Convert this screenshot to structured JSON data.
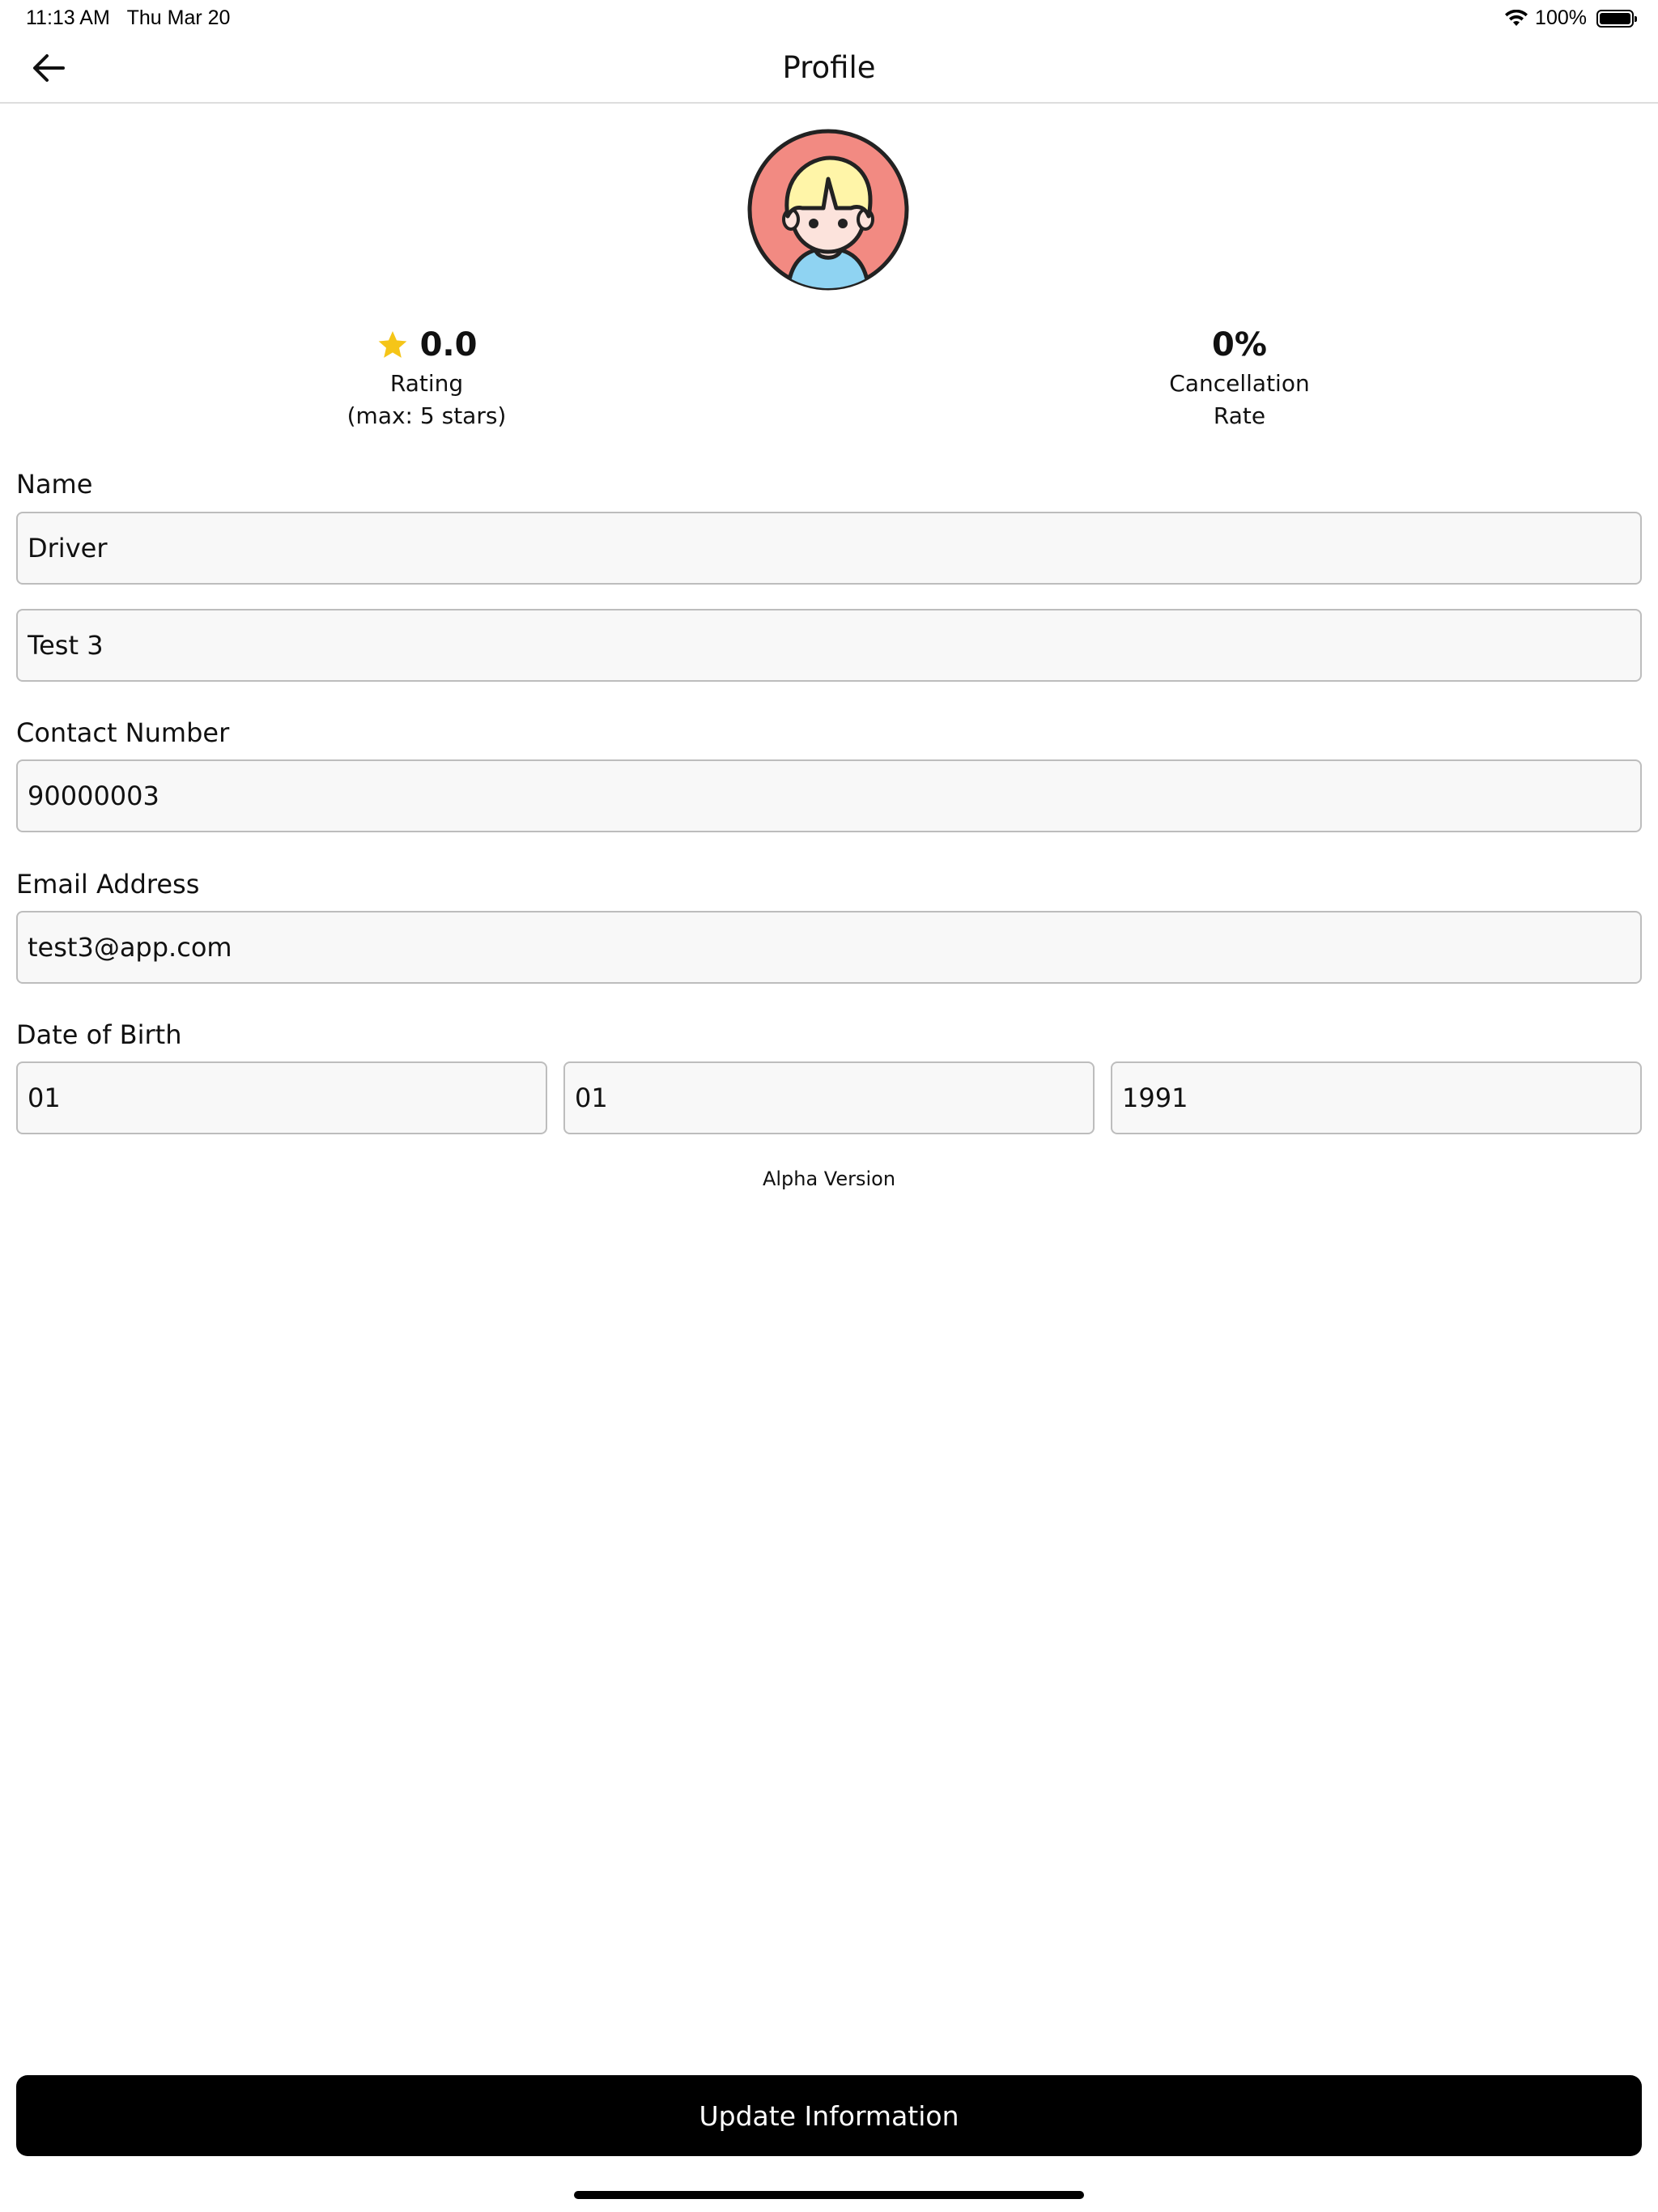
{
  "status_bar": {
    "time": "11:13 AM",
    "date": "Thu Mar 20",
    "battery_text": "100%",
    "battery_level": 1.0
  },
  "header": {
    "title": "Profile"
  },
  "stats": {
    "rating_value": "0.0",
    "rating_label_line1": "Rating",
    "rating_label_line2": "(max: 5 stars)",
    "cancellation_value": "0%",
    "cancellation_label_line1": "Cancellation",
    "cancellation_label_line2": "Rate"
  },
  "form": {
    "name_label": "Name",
    "first_name_value": "Driver",
    "last_name_value": "Test 3",
    "contact_label": "Contact Number",
    "contact_value": "90000003",
    "email_label": "Email Address",
    "email_value": "test3@app.com",
    "dob_label": "Date of Birth",
    "dob_day_value": "01",
    "dob_month_value": "01",
    "dob_year_value": "1991"
  },
  "version_text": "Alpha Version",
  "actions": {
    "update_label": "Update Information"
  },
  "colors": {
    "avatar_bg": "#F28A82",
    "avatar_hair": "#FFF5A8",
    "avatar_shirt": "#8FD3F2",
    "avatar_skin": "#FCE3DC",
    "star": "#F5C518",
    "button_bg": "#000000"
  },
  "icons": {
    "back": "arrow-left-icon",
    "star": "star-icon",
    "wifi": "wifi-icon",
    "battery": "battery-icon"
  }
}
